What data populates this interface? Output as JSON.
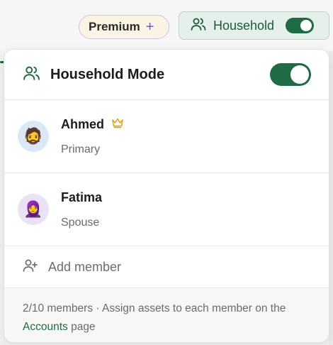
{
  "topbar": {
    "premium_label": "Premium",
    "premium_plus": "+",
    "household_label": "Household",
    "household_toggle_on": true
  },
  "panel": {
    "title": "Household Mode",
    "mode_enabled": true,
    "members": [
      {
        "name": "Ahmed",
        "role": "Primary",
        "avatar": "🧔",
        "badge": "crown-icon"
      },
      {
        "name": "Fatima",
        "role": "Spouse",
        "avatar": "🧕",
        "badge": ""
      }
    ],
    "add_member_label": "Add member",
    "footer": {
      "text_before": "2/10 members · Assign assets to each member on the ",
      "link_text": "Accounts",
      "text_after": " page"
    }
  },
  "colors": {
    "accent_green": "#1f6b46",
    "premium_purple": "#7c4dff",
    "crown_gold": "#e0a21a"
  }
}
